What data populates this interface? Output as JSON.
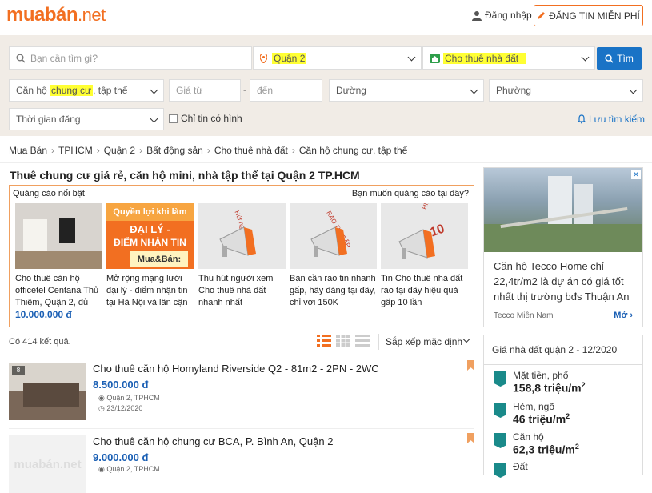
{
  "header": {
    "logo_main": "muabán",
    "logo_tld": ".net",
    "login": "Đăng nhập",
    "post_button": "ĐĂNG TIN MIỄN PHÍ"
  },
  "search": {
    "keyword_placeholder": "Bạn cần tìm gì?",
    "district": "Quận 2",
    "category": "Cho thuê nhà đất",
    "button": "Tìm",
    "subcategory": "Căn hộ chung cư, tập thể",
    "price_from_placeholder": "Giá từ",
    "price_to_placeholder": "đến",
    "street": "Đường",
    "ward": "Phường",
    "time": "Thời gian đăng",
    "only_images": "Chỉ tin có hình",
    "save_search": "Lưu tìm kiếm"
  },
  "breadcrumb": [
    "Mua Bán",
    "TPHCM",
    "Quận 2",
    "Bất động sản",
    "Cho thuê nhà đất",
    "Căn hộ chung cư, tập thể"
  ],
  "page_title": "Thuê chung cư giá rẻ, căn hộ mini, nhà tập thể tại Quận 2 TP.HCM",
  "ads": {
    "heading": "Quảng cáo nổi bật",
    "question": "Bạn muốn quảng cáo tại đây?",
    "items": [
      {
        "text": "Cho thuê căn hộ officetel Centana Thủ Thiêm, Quận 2, đủ",
        "price": "10.000.000 đ"
      },
      {
        "text": "Mở rộng mạng lưới đại lý - điểm nhận tin tại Hà Nội và lân cận",
        "price": ""
      },
      {
        "text": "Thu hút người xem Cho thuê nhà đất nhanh nhất",
        "price": ""
      },
      {
        "text": "Bạn cần rao tin nhanh gấp, hãy đăng tại đây, chỉ với 150K",
        "price": ""
      },
      {
        "text": "Tin Cho thuê nhà đất rao tại đây hiệu quả gấp 10 lần",
        "price": ""
      }
    ],
    "banner2_line1": "Quyền lợi khi làm",
    "banner2_line2": "ĐẠI LÝ -",
    "banner2_line3": "ĐIỂM NHẬN TIN",
    "banner2_line4": "Mua&Bán:",
    "banner3": "Hút người xem",
    "banner4": "RAO TIN GẤP",
    "banner5a": "HIỆU QUẢ GẤP",
    "banner5b": "10"
  },
  "results": {
    "count": "Có 414 kết quả.",
    "sort": "Sắp xếp mặc định"
  },
  "listings": [
    {
      "title": "Cho thuê căn hộ Homyland Riverside Q2 - 81m2 - 2PN - 2WC",
      "price": "8.500.000 đ",
      "location": "Quận 2, TPHCM",
      "date": "23/12/2020",
      "photo_count": "8"
    },
    {
      "title": "Cho thuê căn hộ chung cư BCA, P. Bình An, Quận 2",
      "price": "9.000.000 đ",
      "location": "Quận 2, TPHCM",
      "date": "",
      "photo_count": ""
    }
  ],
  "placeholder_logo": "muabán.net",
  "sidebar_ad": {
    "text": "Căn hộ Tecco Home chỉ 22,4tr/m2 là dự án có giá tốt nhất thị trường bđs Thuận An",
    "source": "Tecco Miền Nam",
    "more": "Mở"
  },
  "price_box": {
    "heading": "Giá nhà đất quận 2 - 12/2020",
    "rows": [
      {
        "label": "Mặt tiền, phố",
        "value": "158,8 triệu/m",
        "sup": "2"
      },
      {
        "label": "Hẻm, ngõ",
        "value": "46 triệu/m",
        "sup": "2"
      },
      {
        "label": "Căn hộ",
        "value": "62,3 triệu/m",
        "sup": "2"
      },
      {
        "label": "Đất",
        "value": "",
        "sup": ""
      }
    ]
  },
  "colors": {
    "brand": "#f26f21",
    "link": "#1a5fb4",
    "button": "#1a73c6",
    "highlight": "#ffff33"
  }
}
